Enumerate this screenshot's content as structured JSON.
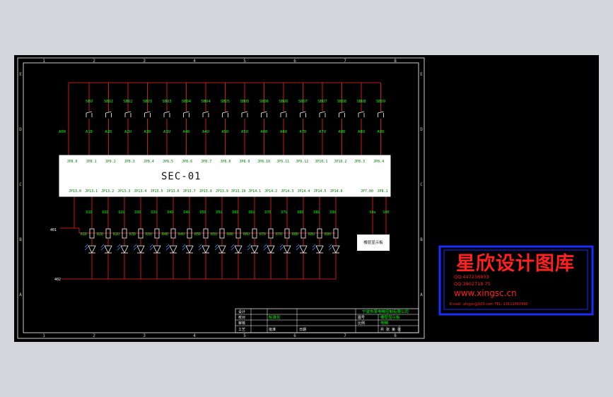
{
  "diagram": {
    "main_label": "SEC-01",
    "buttons": [
      "SBU",
      "SBD2",
      "SBU2",
      "SBD3",
      "SBU3",
      "SBD4",
      "SBU4",
      "SBD5",
      "SBU5",
      "SBD6",
      "SBU6",
      "SBD7",
      "SBU7",
      "SBD8",
      "SBU8",
      "SBD9"
    ],
    "contacts": [
      "A00",
      "A1D",
      "A2D",
      "A2U",
      "A3D",
      "A3U",
      "A4D",
      "A4U",
      "A5D",
      "A5U",
      "A6D",
      "A6U",
      "A7D",
      "A7U",
      "A8D",
      "A8U",
      "A9D"
    ],
    "top_pins": [
      "JP8.0",
      "JP8.1",
      "JP9.2",
      "JP8.3",
      "JP8.4",
      "JP8.5",
      "JP8.6",
      "JP8.7",
      "JP8.8",
      "JP8.9",
      "JP8.10",
      "JP9.11",
      "JP9.12",
      "JP10.1",
      "JP10.2",
      "JP8.3",
      "JP8.4"
    ],
    "bottom_pins": [
      "JP13.0",
      "JP13.1",
      "JP13.2",
      "JP13.3",
      "JP13.4",
      "JP13.5",
      "JP13.6",
      "JP13.7",
      "JP13.8",
      "JP13.9",
      "JP13.10",
      "JP14.1",
      "JP14.2",
      "JP14.3",
      "JP14.4",
      "JP14.5",
      "JP14.6",
      "JP7.00",
      "JP8.1"
    ],
    "outputs": [
      "D1D",
      "D2D",
      "D2U",
      "D3D",
      "D3U",
      "D4D",
      "D4U",
      "D5D",
      "D5U",
      "D6D",
      "D6U",
      "D7D",
      "D7U",
      "D8D",
      "D8U",
      "D9U",
      "S0e",
      "S0E"
    ],
    "resistors": [
      "R1D",
      "R2D",
      "R2U",
      "R3D",
      "R3U",
      "R4D",
      "R4U",
      "R5D",
      "R5U",
      "R6D",
      "R6U",
      "R7D",
      "R7U",
      "R8D",
      "R8U",
      "R9U"
    ],
    "side_box": "楼层显示板",
    "bus_labels": [
      "401",
      "402"
    ],
    "zones_top": [
      "1",
      "2",
      "3",
      "4",
      "5",
      "6",
      "7",
      "8"
    ],
    "zones_side": [
      "E",
      "D",
      "C",
      "B",
      "A"
    ]
  },
  "title_block": {
    "company": "宁波市某电梯控制有限公司",
    "cells": [
      "设计",
      "校对",
      "审核",
      "工艺",
      "标准化",
      "批准",
      "日期",
      "图号",
      "比例",
      "共 张 第 张",
      "楼层显示板",
      "电梯"
    ]
  },
  "watermark": {
    "name": "星欣设计图库",
    "qq1": "QQ:447236933",
    "qq2": "QQ:3902718 75",
    "website": "www.xingsc.cn",
    "contact": "E-mail: xingsc@163.com  TEL: 13111567890"
  },
  "colors": {
    "page": "#d4d6dc",
    "canvas": "#000000",
    "frame": "#ffffff",
    "wire": "#ff2020",
    "text": "#00ff00",
    "led": "#5090ff",
    "watermark_border": "#1a2cff",
    "watermark_text": "#ff2020"
  }
}
